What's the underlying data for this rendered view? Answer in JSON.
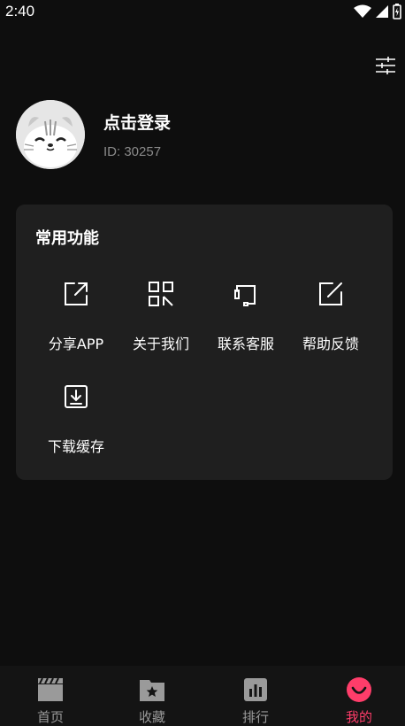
{
  "status_bar": {
    "time": "2:40"
  },
  "profile": {
    "login_text": "点击登录",
    "user_id": "ID: 30257"
  },
  "functions": {
    "title": "常用功能",
    "items": [
      {
        "label": "分享APP",
        "icon": "share-icon"
      },
      {
        "label": "关于我们",
        "icon": "qr-grid-icon"
      },
      {
        "label": "联系客服",
        "icon": "headset-icon"
      },
      {
        "label": "帮助反馈",
        "icon": "edit-icon"
      },
      {
        "label": "下载缓存",
        "icon": "download-icon"
      }
    ]
  },
  "bottom_nav": {
    "items": [
      {
        "label": "首页",
        "icon": "clapperboard-icon"
      },
      {
        "label": "收藏",
        "icon": "star-folder-icon"
      },
      {
        "label": "排行",
        "icon": "bar-chart-icon"
      },
      {
        "label": "我的",
        "icon": "smile-face-icon",
        "active": true
      }
    ]
  },
  "colors": {
    "accent": "#ff3d6a",
    "background": "#0e0e0e",
    "card": "#1f1f1f"
  }
}
